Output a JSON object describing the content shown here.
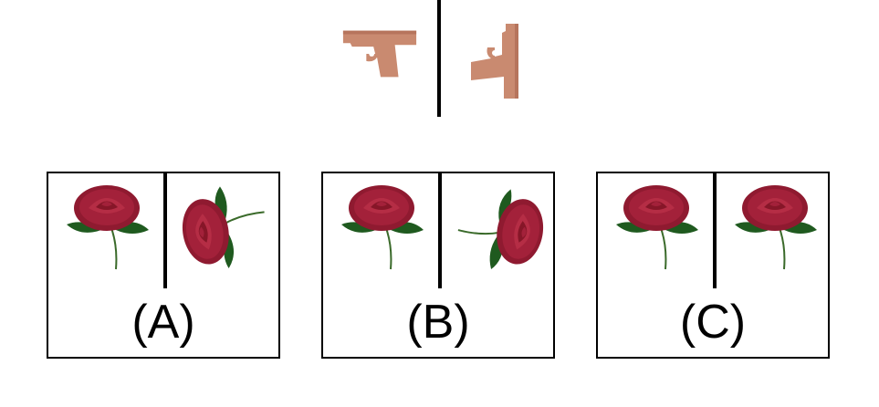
{
  "prompt": {
    "left_icon": "pistol-icon",
    "right_icon": "pistol-rotated-icon",
    "icon_color": "#c98a70"
  },
  "options": [
    {
      "label": "(A)",
      "left_icon": "rose-icon",
      "right_icon": "rose-rotated-icon"
    },
    {
      "label": "(B)",
      "left_icon": "rose-icon",
      "right_icon": "rose-rotated-icon"
    },
    {
      "label": "(C)",
      "left_icon": "rose-icon",
      "right_icon": "rose-icon"
    }
  ],
  "colors": {
    "rose_petal": "#a3213a",
    "rose_leaf": "#1f5a1f",
    "stem": "#3a6a2a"
  }
}
